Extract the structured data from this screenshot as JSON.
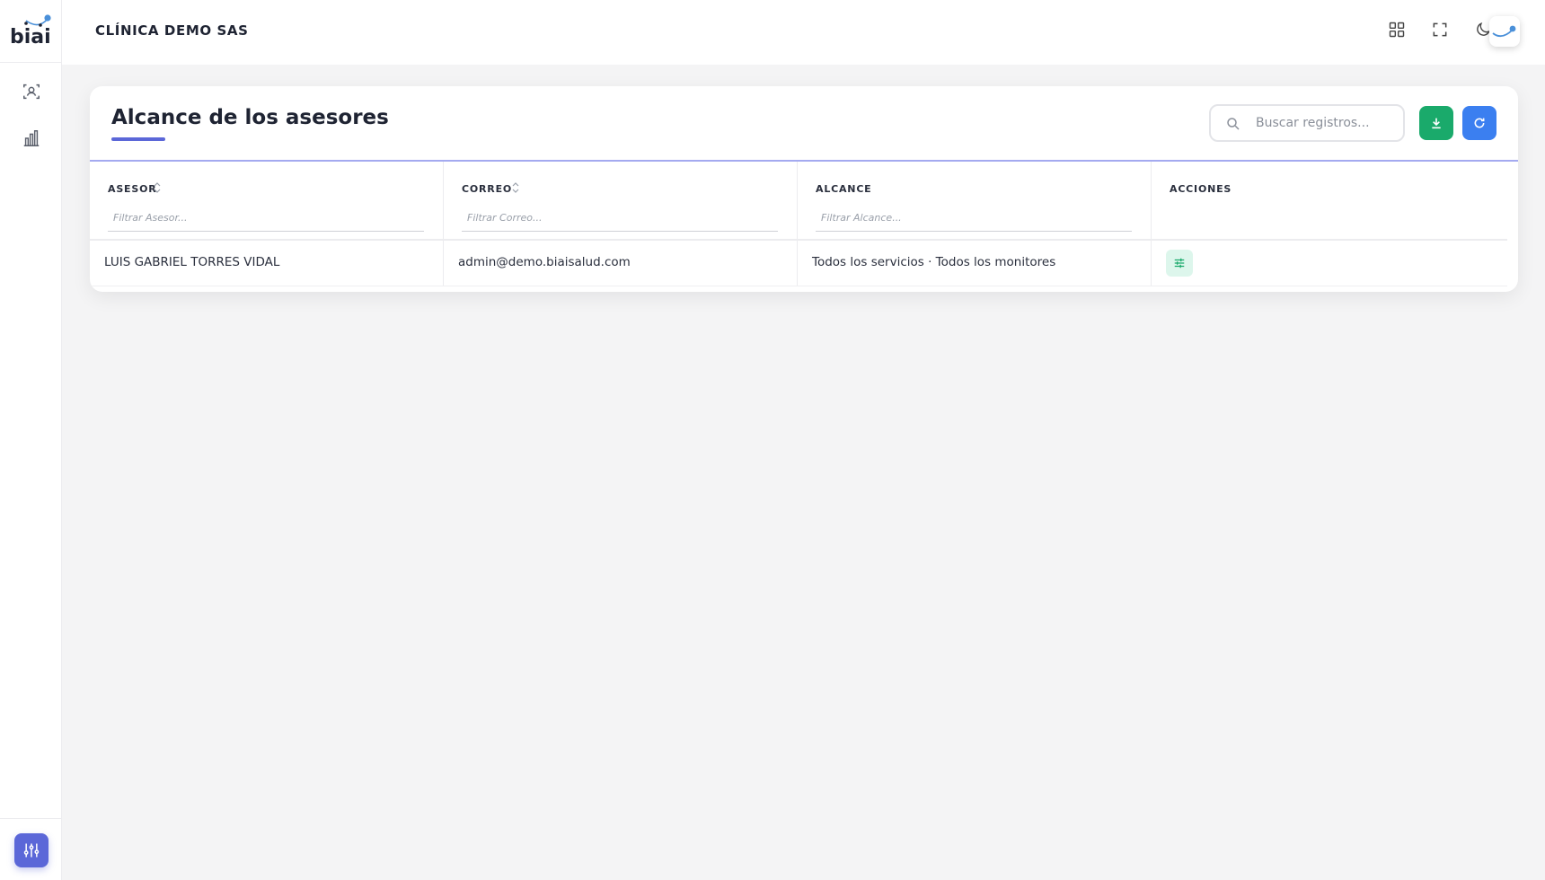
{
  "brand": {
    "logo_text": "biai"
  },
  "sidebar": {
    "items": [
      {
        "icon": "user-scan-icon"
      },
      {
        "icon": "bar-chart-icon"
      }
    ],
    "bottom": {
      "icon": "sliders-icon"
    }
  },
  "header": {
    "org_name": "CLÍNICA DEMO SAS",
    "icons": [
      "grid-icon",
      "fullscreen-icon",
      "moon-icon",
      "avatar-logo-icon"
    ]
  },
  "card": {
    "title": "Alcance de los asesores",
    "search_placeholder": "Buscar registros...",
    "buttons": {
      "download": "download-icon",
      "refresh": "refresh-icon"
    }
  },
  "table": {
    "columns": [
      {
        "label": "ASESOR",
        "sortable": true,
        "filter_placeholder": "Filtrar Asesor..."
      },
      {
        "label": "CORREO",
        "sortable": true,
        "filter_placeholder": "Filtrar Correo..."
      },
      {
        "label": "ALCANCE",
        "sortable": false,
        "filter_placeholder": "Filtrar Alcance..."
      },
      {
        "label": "ACCIONES",
        "sortable": false,
        "filter_placeholder": ""
      }
    ],
    "rows": [
      {
        "asesor": "LUIS GABRIEL TORRES VIDAL",
        "correo": "admin@demo.biaisalud.com",
        "alcance": "Todos los servicios · Todos los monitores",
        "action_icon": "adjust-icon"
      }
    ]
  },
  "colors": {
    "primary": "#5b67d8",
    "download": "#1aaa6b",
    "refresh": "#3b7ff0",
    "action_bg": "#ddf6ec"
  }
}
